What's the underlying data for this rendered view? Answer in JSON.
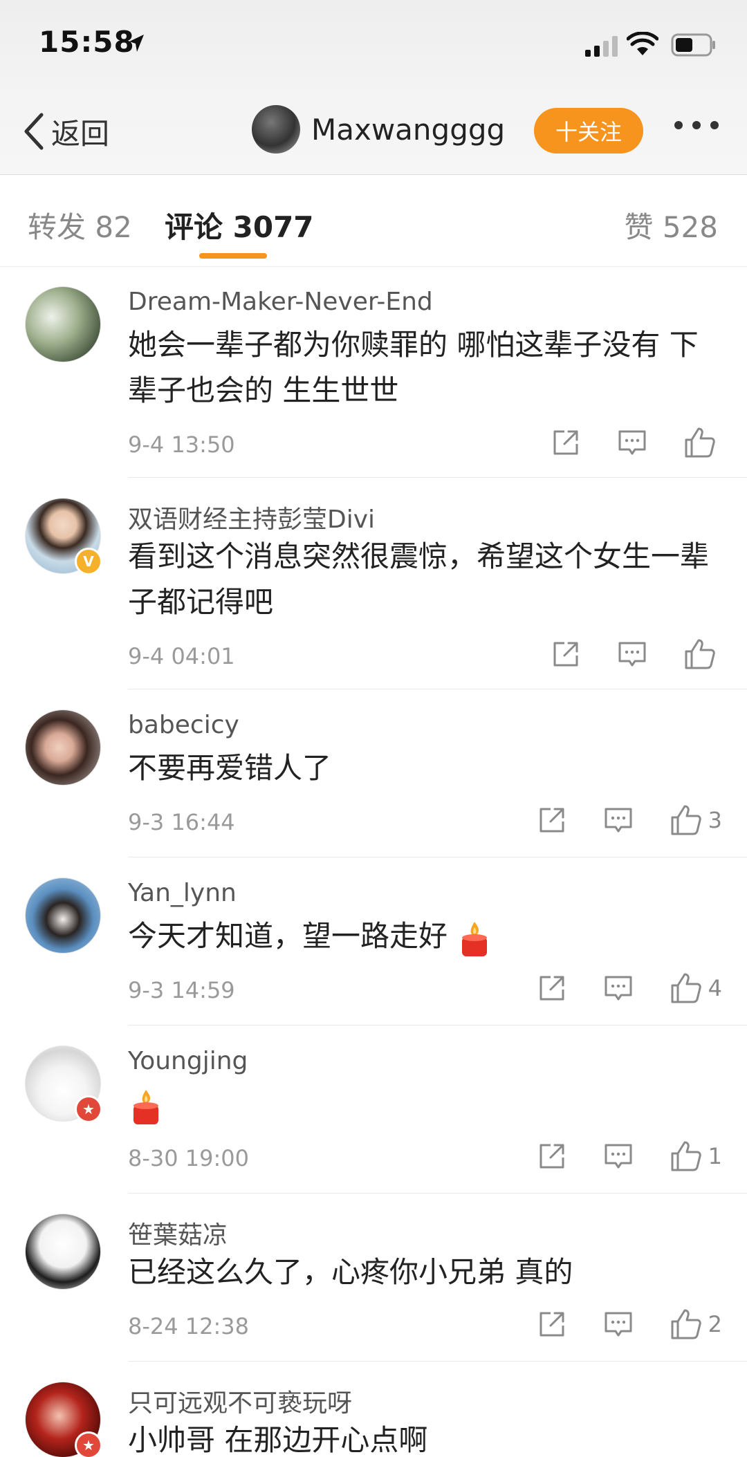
{
  "status_bar": {
    "time": "15:58"
  },
  "nav": {
    "back_label": "返回",
    "author_name": "Maxwangggg",
    "follow_label": "十关注"
  },
  "tabs": {
    "repost": "转发 82",
    "comments": "评论 3077",
    "likes": "赞 528"
  },
  "colors": {
    "accent": "#f7941e",
    "verified_gold": "#f5b12a",
    "badge_red": "#e1483a"
  },
  "comments": [
    {
      "user": "Dream-Maker-Never-End",
      "text": "她会一辈子都为你赎罪的 哪怕这辈子没有 下辈子也会的 生生世世",
      "time": "9-4 13:50",
      "likes": ""
    },
    {
      "user": "双语财经主持彭莹Divi",
      "text": "看到这个消息突然很震惊，希望这个女生一辈子都记得吧",
      "time": "9-4 04:01",
      "likes": ""
    },
    {
      "user": "babecicy",
      "text": "不要再爱错人了",
      "time": "9-3 16:44",
      "likes": "3"
    },
    {
      "user": "Yan_lynn",
      "text": "今天才知道，望一路走好",
      "time": "9-3 14:59",
      "likes": "4"
    },
    {
      "user": "Youngjing",
      "text": "",
      "time": "8-30 19:00",
      "likes": "1"
    },
    {
      "user": "笹葉菇凉",
      "text": "已经这么久了，心疼你小兄弟 真的",
      "time": "8-24 12:38",
      "likes": "2"
    },
    {
      "user": "只可远观不可亵玩呀",
      "text": "小帅哥 在那边开心点啊",
      "time": "",
      "likes": ""
    }
  ]
}
